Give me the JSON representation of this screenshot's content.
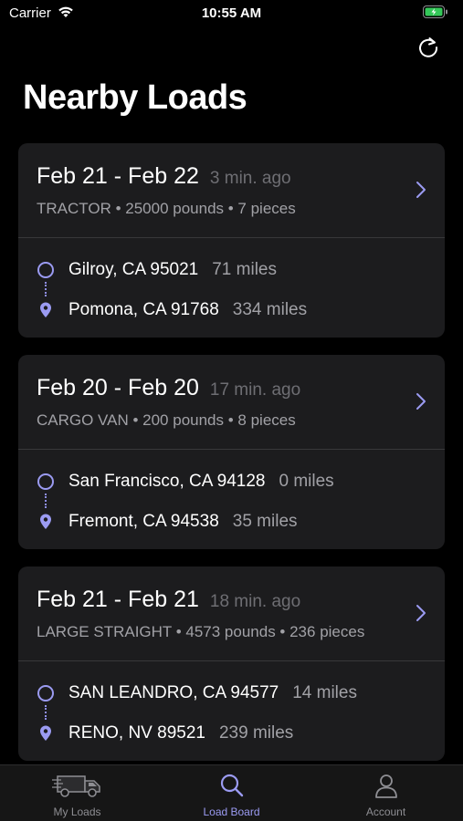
{
  "status": {
    "carrier": "Carrier",
    "time": "10:55 AM"
  },
  "header": {
    "title": "Nearby Loads",
    "refresh_icon": "refresh-icon"
  },
  "loads": [
    {
      "date_range": "Feb 21 - Feb 22",
      "posted": "3 min. ago",
      "meta": "TRACTOR • 25000 pounds • 7 pieces",
      "origin": "Gilroy, CA 95021",
      "origin_miles": "71 miles",
      "destination": "Pomona, CA 91768",
      "destination_miles": "334 miles"
    },
    {
      "date_range": "Feb 20 - Feb 20",
      "posted": "17 min. ago",
      "meta": "CARGO VAN • 200 pounds • 8 pieces",
      "origin": "San Francisco, CA 94128",
      "origin_miles": "0 miles",
      "destination": "Fremont, CA 94538",
      "destination_miles": "35 miles"
    },
    {
      "date_range": "Feb 21 - Feb 21",
      "posted": "18 min. ago",
      "meta": "LARGE STRAIGHT • 4573 pounds • 236 pieces",
      "origin": "SAN LEANDRO, CA 94577",
      "origin_miles": "14 miles",
      "destination": "RENO, NV 89521",
      "destination_miles": "239 miles"
    }
  ],
  "tabs": [
    {
      "label": "My Loads",
      "icon": "truck-icon",
      "active": false
    },
    {
      "label": "Load Board",
      "icon": "search-icon",
      "active": true
    },
    {
      "label": "Account",
      "icon": "person-icon",
      "active": false
    }
  ],
  "colors": {
    "accent": "#9b9bf2",
    "background": "#000000",
    "card": "#1c1c1e",
    "battery": "#34c759"
  }
}
